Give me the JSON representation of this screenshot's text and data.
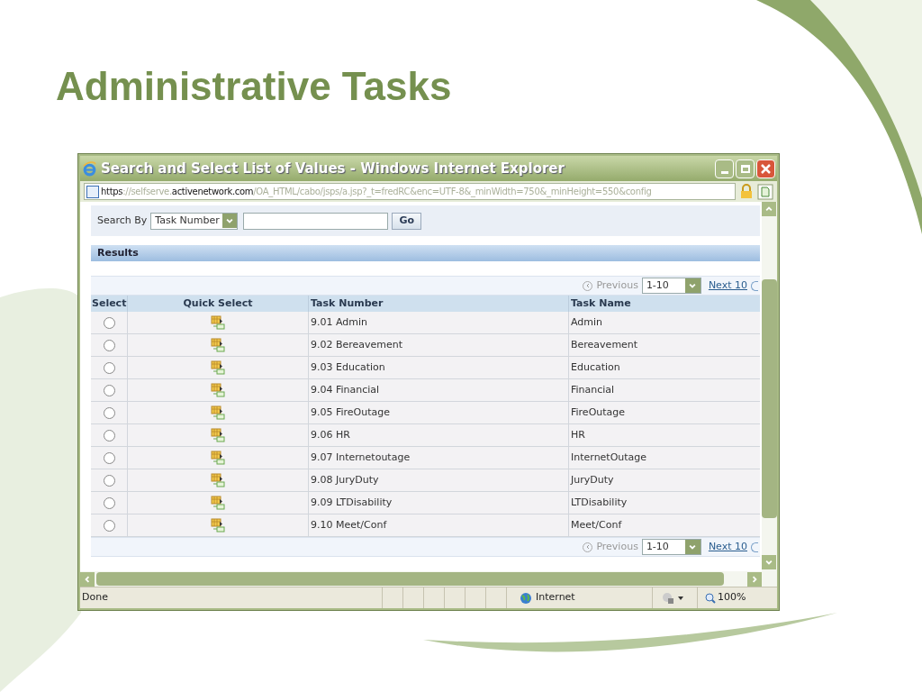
{
  "slide": {
    "title": "Administrative Tasks"
  },
  "window": {
    "title": "Search and Select List of Values - Windows Internet Explorer"
  },
  "address_bar": {
    "scheme": "https",
    "host_prefix": "://selfserve.",
    "domain": "activenetwork.com",
    "path": "/OA_HTML/cabo/jsps/a.jsp?_t=fredRC&enc=UTF-8&_minWidth=750&_minHeight=550&config"
  },
  "search": {
    "label": "Search By",
    "field": "Task Number",
    "button": "Go"
  },
  "results": {
    "heading": "Results",
    "pager_top": {
      "previous": "Previous",
      "range": "1-10",
      "next": "Next 10"
    },
    "columns": [
      "Select",
      "Quick Select",
      "Task Number",
      "Task Name"
    ],
    "rows": [
      {
        "selected": false,
        "task_number": "9.01 Admin",
        "task_name": "Admin"
      },
      {
        "selected": false,
        "task_number": "9.02 Bereavement",
        "task_name": "Bereavement"
      },
      {
        "selected": false,
        "task_number": "9.03 Education",
        "task_name": "Education"
      },
      {
        "selected": false,
        "task_number": "9.04 Financial",
        "task_name": "Financial"
      },
      {
        "selected": false,
        "task_number": "9.05 FireOutage",
        "task_name": "FireOutage"
      },
      {
        "selected": false,
        "task_number": "9.06 HR",
        "task_name": "HR"
      },
      {
        "selected": false,
        "task_number": "9.07 Internetoutage",
        "task_name": "InternetOutage"
      },
      {
        "selected": false,
        "task_number": "9.08 JuryDuty",
        "task_name": "JuryDuty"
      },
      {
        "selected": false,
        "task_number": "9.09 LTDisability",
        "task_name": "LTDisability"
      },
      {
        "selected": false,
        "task_number": "9.10 Meet/Conf",
        "task_name": "Meet/Conf"
      }
    ],
    "pager_bottom": {
      "previous": "Previous",
      "range": "1-10",
      "next": "Next 10"
    }
  },
  "status_bar": {
    "text": "Done",
    "zone": "Internet",
    "zoom": "100%"
  }
}
